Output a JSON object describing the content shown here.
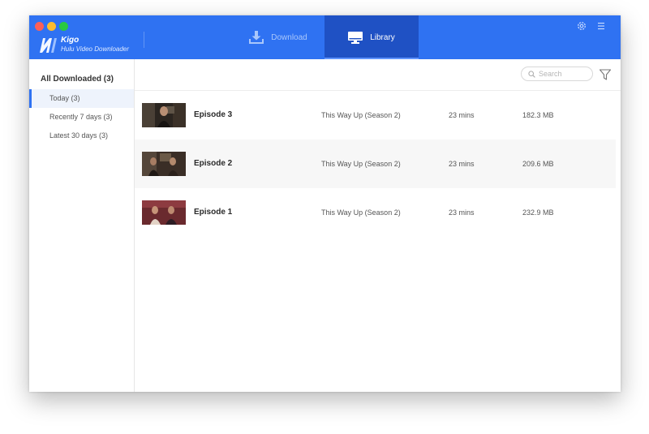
{
  "app": {
    "name": "Kigo",
    "subtitle": "Hulu Video Downloader"
  },
  "tabs": [
    {
      "label": "Download",
      "icon": "download-icon",
      "active": false
    },
    {
      "label": "Library",
      "icon": "monitor-icon",
      "active": true
    }
  ],
  "top_icons": [
    "gear-icon",
    "menu-icon"
  ],
  "sidebar": {
    "heading": "All Downloaded (3)",
    "items": [
      {
        "label": "Today (3)",
        "active": true
      },
      {
        "label": "Recently 7 days (3)",
        "active": false
      },
      {
        "label": "Latest 30 days (3)",
        "active": false
      }
    ]
  },
  "toolbar": {
    "search_placeholder": "Search",
    "filter_icon": "filter-icon"
  },
  "videos": [
    {
      "title": "Episode 3",
      "series": "This Way Up (Season 2)",
      "duration": "23 mins",
      "size": "182.3 MB"
    },
    {
      "title": "Episode 2",
      "series": "This Way Up (Season 2)",
      "duration": "23 mins",
      "size": "209.6 MB"
    },
    {
      "title": "Episode 1",
      "series": "This Way Up (Season 2)",
      "duration": "23 mins",
      "size": "232.9 MB"
    }
  ],
  "colors": {
    "accent": "#2f72f2",
    "active_tab": "#1f51c4",
    "selected_row_bg": "#eef3fc"
  }
}
